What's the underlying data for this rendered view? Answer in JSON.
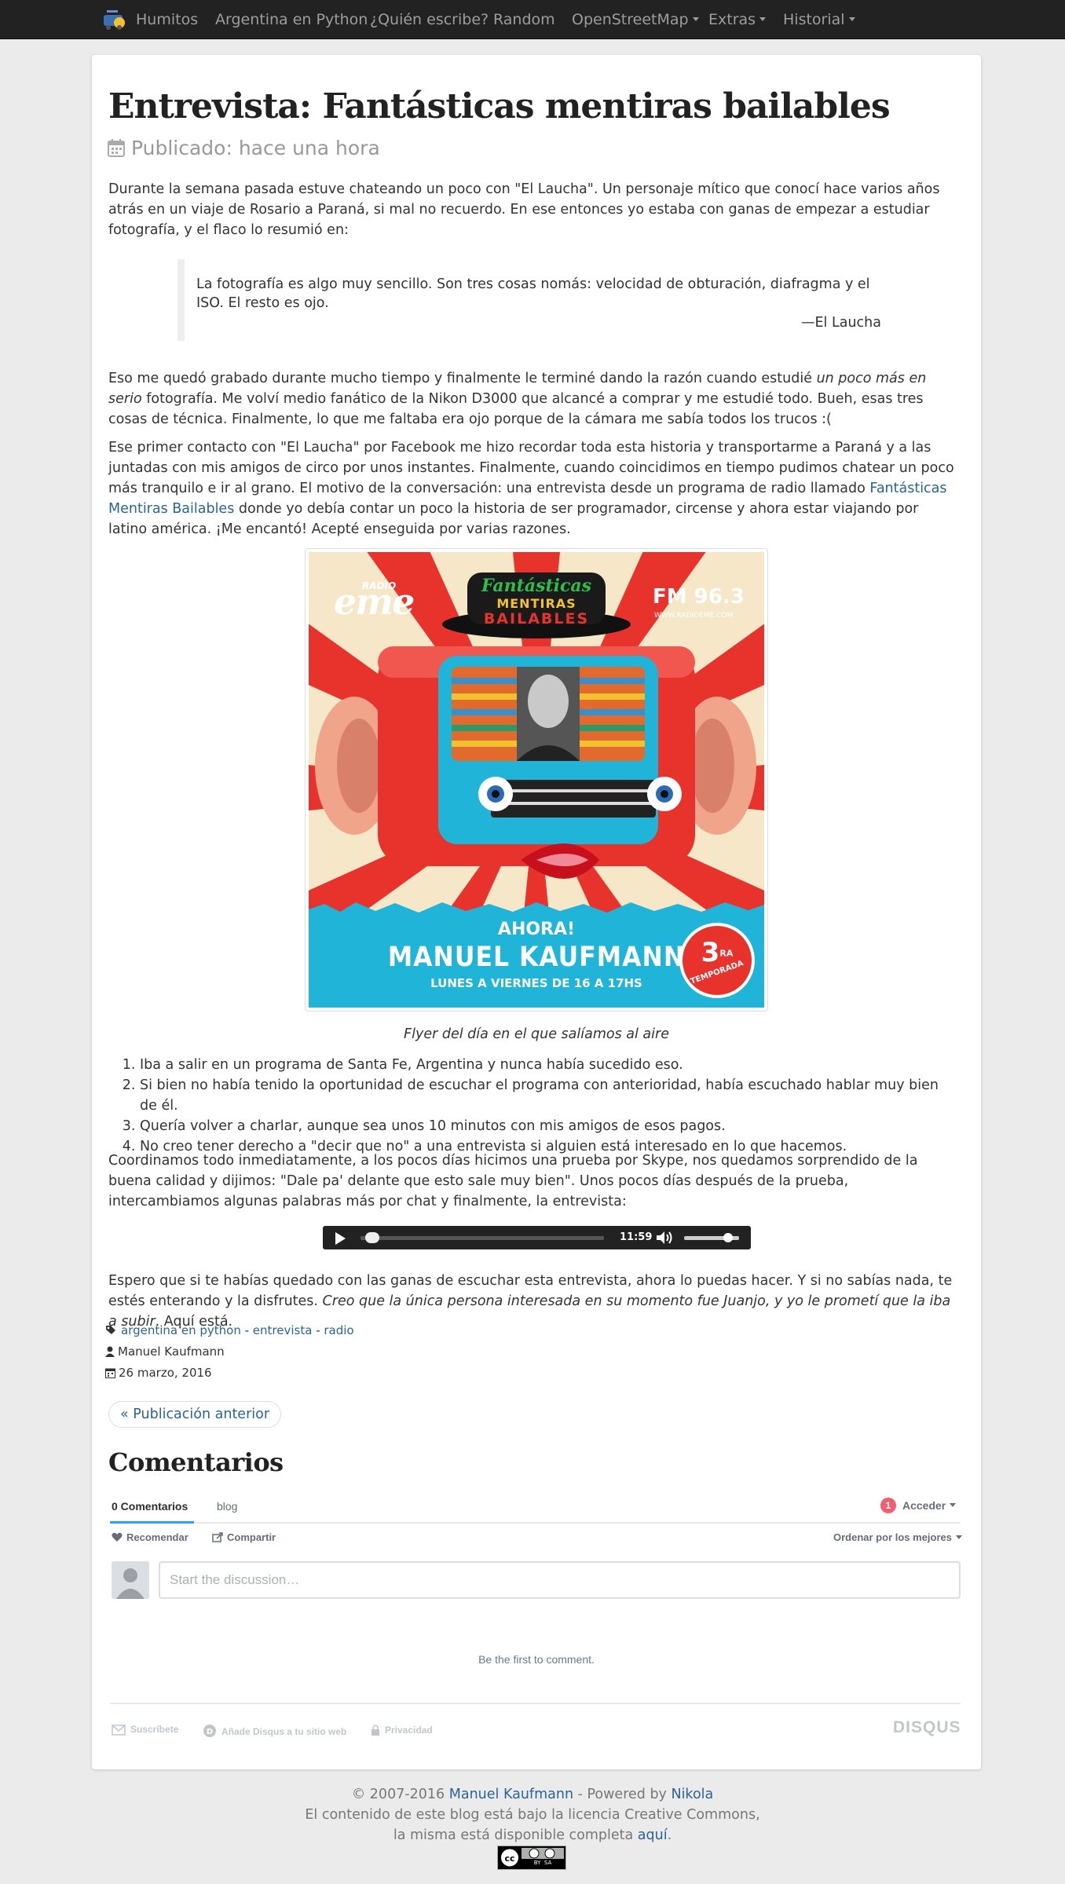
{
  "nav": {
    "brand": "Humitos",
    "items": [
      "Argentina en Python",
      "¿Quién escribe?",
      "Random",
      "OpenStreetMap",
      "Extras",
      "Historial"
    ]
  },
  "post": {
    "title": "Entrevista: Fantásticas mentiras bailables",
    "published": "Publicado: hace una hora",
    "intro": "Durante la semana pasada estuve chateando un poco con \"El Laucha\". Un personaje mítico que conocí hace varios años atrás en un viaje de Rosario a Paraná, si mal no recuerdo. En ese entonces yo estaba con ganas de empezar a estudiar fotografía, y el flaco lo resumió en:",
    "quote": "La fotografía es algo muy sencillo. Son tres cosas nomás: velocidad de obturación, diafragma y el ISO. El resto es ojo.",
    "quote_author": "—El Laucha",
    "p2_start": "Eso me quedó grabado durante mucho tiempo y finalmente le terminé dando la razón cuando estudié ",
    "p2_italic": "un poco más en serio",
    "p2_end": " fotografía. Me volví medio fanático de la Nikon D3000 que alcancé a comprar y me estudié todo. Bueh, esas tres cosas de técnica. Finalmente, lo que me faltaba era ojo porque de la cámara me sabía todos los trucos :(",
    "p3_start": "Ese primer contacto con \"El Laucha\" por Facebook me hizo recordar toda esta historia y transportarme a Paraná y a las juntadas con mis amigos de circo por unos instantes. Finalmente, cuando coincidimos en tiempo pudimos chatear un poco más tranquilo e ir al grano. El motivo de la conversación: una entrevista desde un programa de radio llamado ",
    "p3_link": "Fantásticas Mentiras Bailables",
    "p3_end": " donde yo debía contar un poco la historia de ser programador, circense y ahora estar viajando por latino américa. ¡Me encantó! Acepté enseguida por varias razones.",
    "caption": "Flyer del día en el que salíamos al aire",
    "reasons": [
      "Iba a salir en un programa de Santa Fe, Argentina y nunca había sucedido eso.",
      "Si bien no había tenido la oportunidad de escuchar el programa con anterioridad, había escuchado hablar muy bien de él.",
      "Quería volver a charlar, aunque sea unos 10 minutos con mis amigos de esos pagos.",
      "No creo tener derecho a \"decir que no\" a una entrevista si alguien está interesado en lo que hacemos."
    ],
    "p4": "Coordinamos todo inmediatamente, a los pocos días hicimos una prueba por Skype, nos quedamos sorprendido de la buena calidad y dijimos: \"Dale pa' delante que esto sale muy bien\". Unos pocos días después de la prueba, intercambiamos algunas palabras más por chat y finalmente, la entrevista:",
    "p5_start": "Espero que si te habías quedado con las ganas de escuchar esta entrevista, ahora lo puedas hacer. Y si no sabías nada, te estés enterando y la disfrutes. ",
    "p5_italic": "Creo que la única persona interesada en su momento fue Juanjo, y yo le prometí que la iba a subir",
    "p5_end": ". Aquí está.",
    "tags": [
      "argentina en python",
      "entrevista",
      "radio"
    ],
    "tag_sep": " - ",
    "author": "Manuel Kaufmann",
    "date": "26 marzo, 2016",
    "prev_link": "« Publicación anterior"
  },
  "player": {
    "time": "11:59",
    "progress": 0.02,
    "volume": 0.8
  },
  "flyer": {
    "radio": "RADIO",
    "brand": "eme",
    "show_1": "Fantásticas",
    "show_2": "MENTIRAS",
    "show_3": "BAILABLES",
    "fm": "FM 96.3",
    "web": "WWW.RADIOEME.COM",
    "ahora": "AHORA!",
    "host": "MANUEL KAUFMANN",
    "schedule": "LUNES A VIERNES DE 16 A 17HS",
    "season_num": "3",
    "season_sup": "RA",
    "season_word": "TEMPORADA"
  },
  "comments": {
    "title": "Comentarios",
    "tab_count": "0 Comentarios",
    "tab_blog": "blog",
    "login_badge": "1",
    "login": "Acceder",
    "recommend": "Recomendar",
    "share": "Compartir",
    "sort": "Ordenar por los mejores",
    "placeholder": "Start the discussion…",
    "empty": "Be the first to comment.",
    "subscribe": "Suscríbete",
    "add_disqus": "Añade Disqus a tu sitio web",
    "privacy": "Privacidad",
    "logo": "DISQUS"
  },
  "footer": {
    "copy": "© 2007-2016 ",
    "author": "Manuel Kaufmann",
    "powered": " - Powered by ",
    "nikola": "Nikola",
    "license_1": "El contenido de este blog está bajo la licencia Creative Commons,",
    "license_2": "la misma está disponible completa ",
    "license_link": "aquí",
    "license_end": ".",
    "cc_text": "BY  SA"
  },
  "colors": {
    "link": "#2a6496",
    "navbar": "#222222",
    "flyer_red": "#e8322c",
    "flyer_cyan": "#1fb4d8"
  }
}
